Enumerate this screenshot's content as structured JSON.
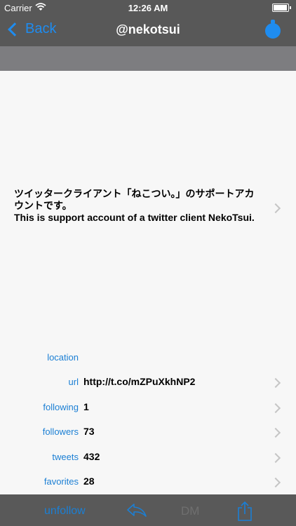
{
  "status_bar": {
    "carrier": "Carrier",
    "time": "12:26 AM"
  },
  "nav": {
    "back_label": "Back",
    "title": "@nekotsui"
  },
  "profile": {
    "bio_line1": "ツイッタークライアント「ねこつい。」のサポートアカ",
    "bio_line2": "ウントです。",
    "bio_line3": "This is support account of a twitter client NekoTsui."
  },
  "details": [
    {
      "label": "location",
      "value": ""
    },
    {
      "label": "url",
      "value": "http://t.co/mZPuXkhNP2"
    },
    {
      "label": "following",
      "value": "1"
    },
    {
      "label": "followers",
      "value": "73"
    },
    {
      "label": "tweets",
      "value": "432"
    },
    {
      "label": "favorites",
      "value": "28"
    }
  ],
  "toolbar": {
    "unfollow_label": "unfollow",
    "dm_label": "DM"
  },
  "colors": {
    "accent": "#1e8cf0",
    "bar": "#585858",
    "banner": "#7d7d80",
    "background": "#f7f7f7"
  },
  "icons": [
    "wifi-icon",
    "battery-icon",
    "back-chevron-icon",
    "more-icon",
    "chevron-right-icon",
    "reply-icon",
    "share-icon"
  ]
}
